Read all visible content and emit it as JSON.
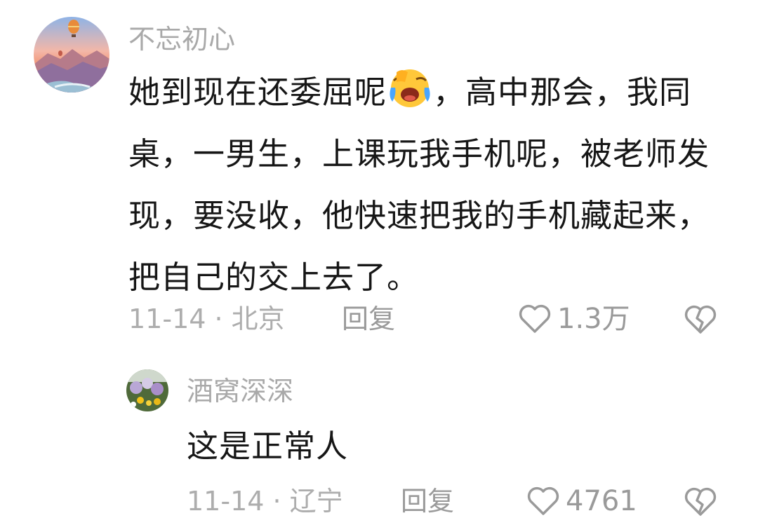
{
  "comment": {
    "username": "不忘初心",
    "text_before_emoji": "她到现在还委屈呢",
    "emoji_icon": "crying-laughing-emoji",
    "text_after_emoji": "，高中那会，我同桌，一男生，上课玩我手机呢，被老师发现，要没收，他快速把我的手机藏起来，把自己的交上去了。",
    "meta": "11-14 · 北京",
    "reply_label": "回复",
    "like_count": "1.3万",
    "like_icon": "heart-outline-icon",
    "dislike_icon": "broken-heart-icon"
  },
  "reply": {
    "username": "酒窝深深",
    "text": "这是正常人",
    "meta": "11-14 · 辽宁",
    "reply_label": "回复",
    "like_count": "4761",
    "like_icon": "heart-outline-icon",
    "dislike_icon": "broken-heart-icon"
  },
  "colors": {
    "text": "#161616",
    "muted": "#a9a9a9",
    "icon": "#9a9a9a"
  }
}
